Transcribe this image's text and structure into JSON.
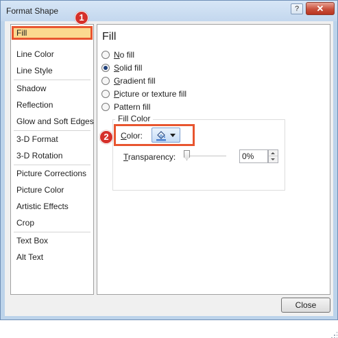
{
  "window": {
    "title": "Format Shape",
    "help_label": "?",
    "close_label": "✕"
  },
  "nav": {
    "items": [
      {
        "label": "Fill",
        "selected": true
      },
      {
        "label": "Line Color"
      },
      {
        "label": "Line Style"
      },
      {
        "label": "Shadow"
      },
      {
        "label": "Reflection"
      },
      {
        "label": "Glow and Soft Edges"
      },
      {
        "label": "3-D Format"
      },
      {
        "label": "3-D Rotation"
      },
      {
        "label": "Picture Corrections"
      },
      {
        "label": "Picture Color"
      },
      {
        "label": "Artistic Effects"
      },
      {
        "label": "Crop"
      },
      {
        "label": "Text Box"
      },
      {
        "label": "Alt Text"
      }
    ]
  },
  "panel": {
    "title": "Fill",
    "options": [
      {
        "accel": "N",
        "rest": "o fill",
        "checked": false
      },
      {
        "accel": "S",
        "rest": "olid fill",
        "checked": true
      },
      {
        "accel": "G",
        "rest": "radient fill",
        "checked": false
      },
      {
        "accel": "P",
        "rest": "icture or texture fill",
        "checked": false
      },
      {
        "accel": "",
        "rest": "Pattern fill",
        "checked": false
      }
    ],
    "fill_color": {
      "legend": "Fill Color",
      "color_label_accel": "C",
      "color_label_rest": "olor:",
      "transparency_label_accel": "T",
      "transparency_label_rest": "ransparency:",
      "transparency_value": "0%",
      "transparency_level": 0
    }
  },
  "annotations": {
    "badge_1": "1",
    "badge_2": "2",
    "highlight_color": "#e8552f",
    "badge_color": "#d5302a"
  },
  "footer": {
    "close_label": "Close"
  }
}
